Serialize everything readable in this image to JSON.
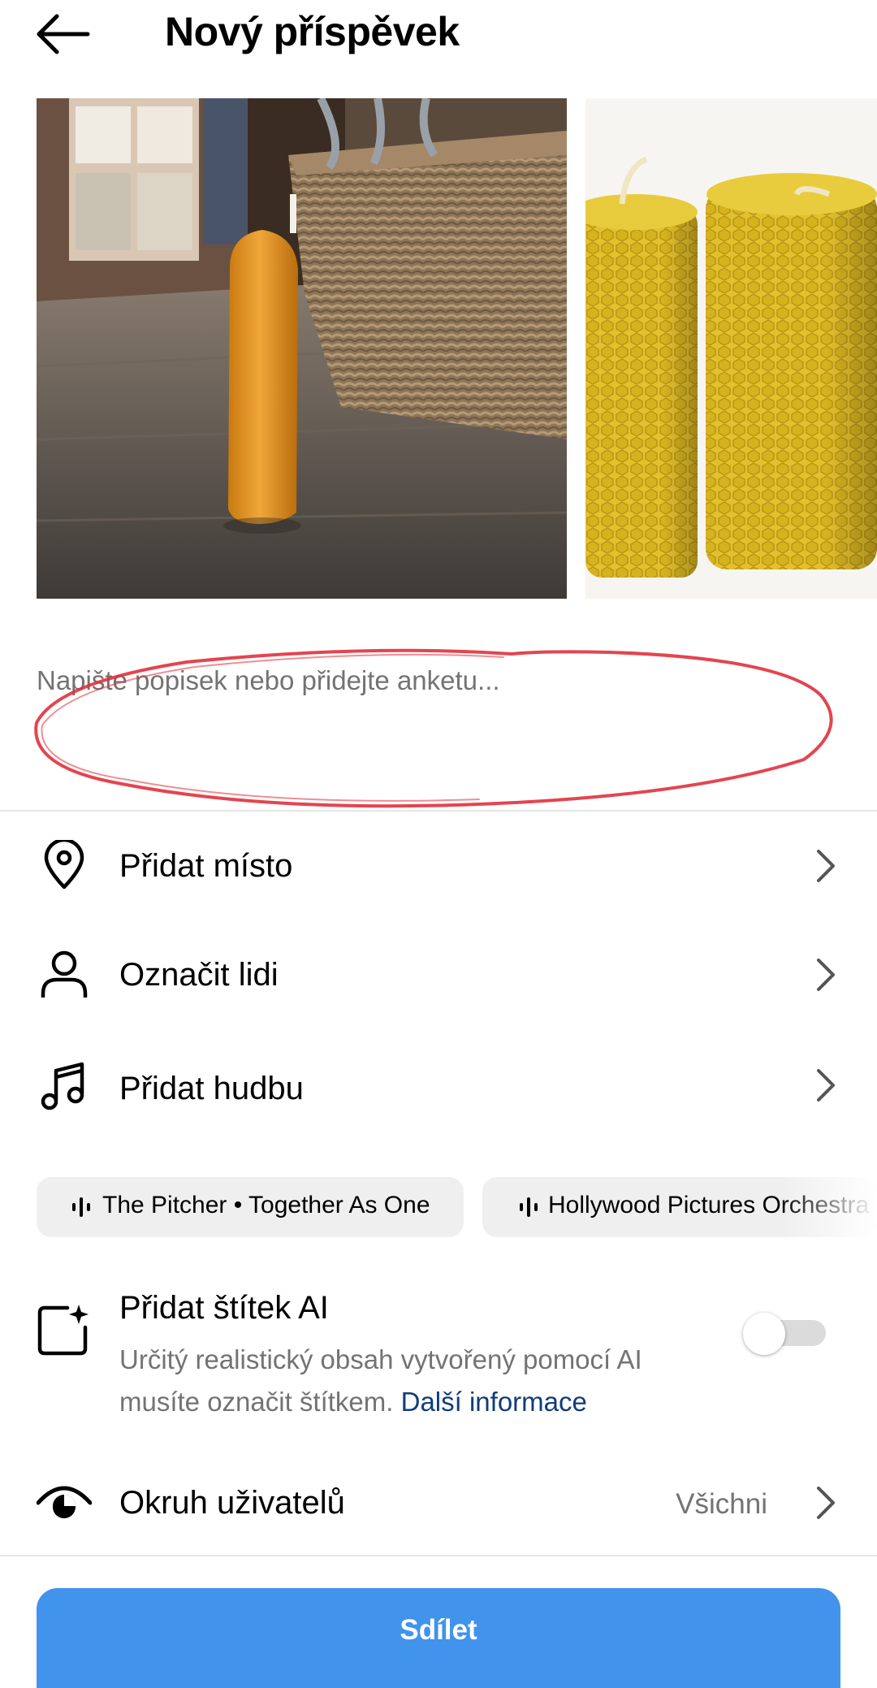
{
  "header": {
    "title": "Nový příspěvek",
    "back_icon": "arrow-left-icon"
  },
  "caption": {
    "placeholder": "Napište popisek nebo přidejte anketu...",
    "value": ""
  },
  "options": [
    {
      "label": "Přidat místo",
      "icon": "location-pin-icon"
    },
    {
      "label": "Označit lidi",
      "icon": "person-icon"
    },
    {
      "label": "Přidat hudbu",
      "icon": "music-note-icon"
    }
  ],
  "music_suggestions": [
    {
      "label": "The Pitcher • Together As One"
    },
    {
      "label": "Hollywood Pictures Orchestra"
    }
  ],
  "ai_label": {
    "title": "Přidat štítek AI",
    "description": "Určitý realistický obsah vytvořený pomocí AI musíte označit štítkem.",
    "link": "Další informace",
    "enabled": false
  },
  "audience": {
    "label": "Okruh uživatelů",
    "value": "Všichni",
    "icon": "eye-icon"
  },
  "share_button": "Sdílet",
  "colors": {
    "primary_button": "#4193ec",
    "link": "#0f3d7a",
    "secondary_text": "#737373",
    "annotation": "#e0313c"
  }
}
